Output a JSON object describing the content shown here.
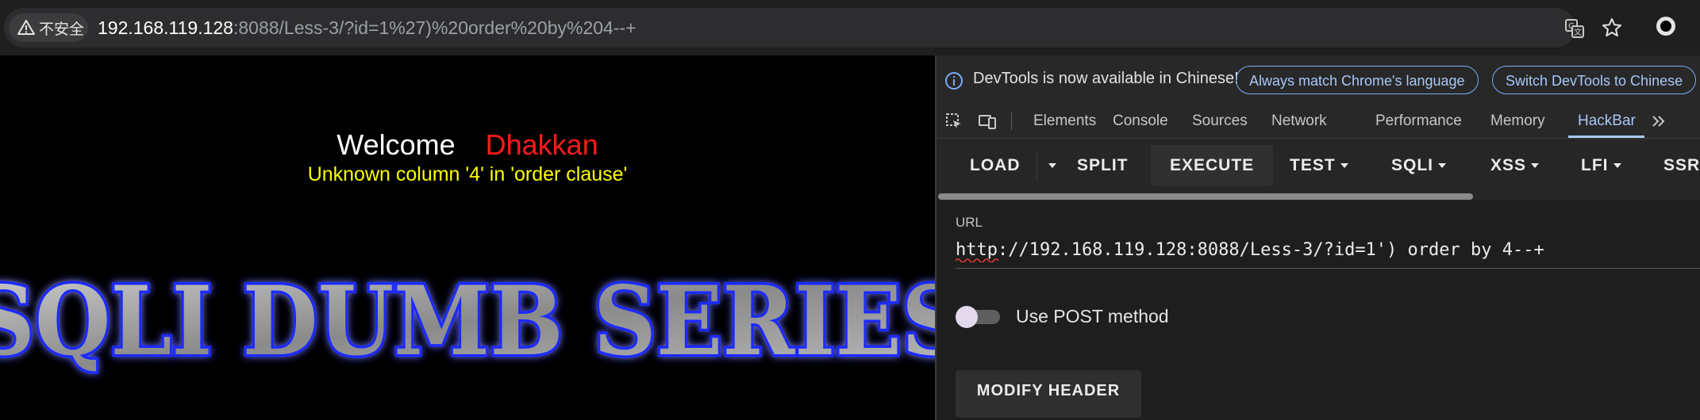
{
  "browser": {
    "security_label": "不安全",
    "url_host": "192.168.119.128",
    "url_rest": ":8088/Less-3/?id=1%27)%20order%20by%204--+",
    "icons": [
      "translate-icon",
      "bookmark-star-icon",
      "profile-icon"
    ]
  },
  "page": {
    "welcome_label": "Welcome",
    "welcome_user": "Dhakkan",
    "error_message": "Unknown column '4' in 'order clause'",
    "banner_text": "SQLI DUMB SERIES",
    "colors": {
      "welcome": "#ffffff",
      "user": "#ff1a1a",
      "error": "#ffff00",
      "banner_glow": "#1a2cff"
    }
  },
  "devtools": {
    "info_text": "DevTools is now available in Chinese!",
    "match_language_button": "Always match Chrome's language",
    "switch_chinese_button": "Switch DevTools to Chinese",
    "tabs": [
      "Elements",
      "Console",
      "Sources",
      "Network",
      "Performance",
      "Memory",
      "HackBar"
    ],
    "active_tab": "HackBar"
  },
  "hackbar": {
    "buttons": {
      "load": "LOAD",
      "split": "SPLIT",
      "execute": "EXECUTE",
      "test": "TEST",
      "sqli": "SQLI",
      "xss": "XSS",
      "lfi": "LFI",
      "ssrf": "SSR"
    },
    "url_label": "URL",
    "url_value": "http://192.168.119.128:8088/Less-3/?id=1') order by 4--+",
    "post_method_label": "Use POST method",
    "post_method_enabled": false,
    "modify_header_button": "MODIFY HEADER"
  }
}
